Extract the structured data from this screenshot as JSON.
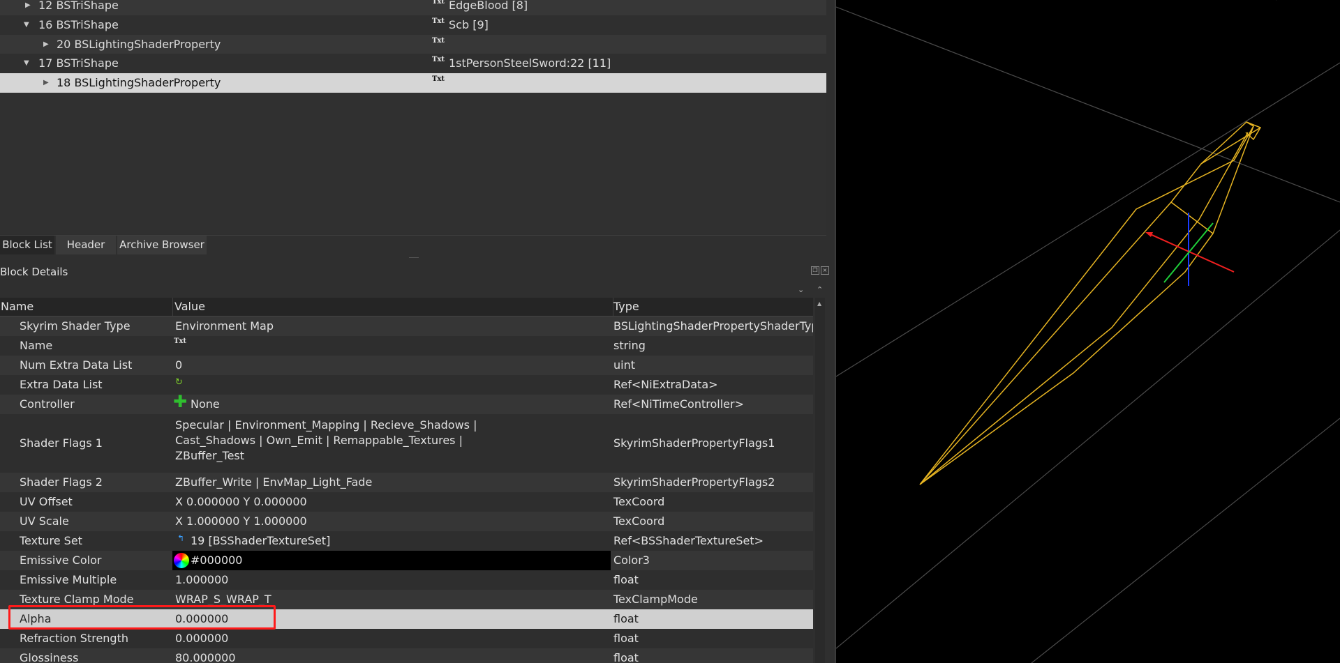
{
  "tree": {
    "rows": [
      {
        "num": "12",
        "name": "BSTriShape",
        "value": "EdgeBlood [8]",
        "txt": "Txt"
      },
      {
        "num": "16",
        "name": "BSTriShape",
        "value": "Scb [9]",
        "txt": "Txt"
      },
      {
        "num": "20",
        "name": "BSLightingShaderProperty",
        "value": "",
        "txt": "Txt"
      },
      {
        "num": "17",
        "name": "BSTriShape",
        "value": "1stPersonSteelSword:22 [11]",
        "txt": "Txt"
      },
      {
        "num": "18",
        "name": "BSLightingShaderProperty",
        "value": "",
        "txt": "Txt"
      }
    ]
  },
  "tabs": [
    "Block List",
    "Header",
    "Archive Browser"
  ],
  "details": {
    "title": "Block Details",
    "headers": {
      "name": "Name",
      "value": "Value",
      "type": "Type"
    },
    "rows": [
      {
        "name": "Skyrim Shader Type",
        "value": "Environment Map",
        "type": "BSLightingShaderPropertyShaderType"
      },
      {
        "name": "Name",
        "value": "Txt",
        "type": "string"
      },
      {
        "name": "Num Extra Data List",
        "value": "0",
        "type": "uint"
      },
      {
        "name": "Extra Data List",
        "value": "",
        "type": "Ref<NiExtraData>"
      },
      {
        "name": "Controller",
        "value": "None",
        "type": "Ref<NiTimeController>"
      },
      {
        "name": "Shader Flags 1",
        "value1": "Specular | Environment_Mapping | Recieve_Shadows |",
        "value2": "Cast_Shadows | Own_Emit | Remappable_Textures |",
        "value3": "ZBuffer_Test",
        "type": "SkyrimShaderPropertyFlags1"
      },
      {
        "name": "Shader Flags 2",
        "value": "ZBuffer_Write | EnvMap_Light_Fade",
        "type": "SkyrimShaderPropertyFlags2"
      },
      {
        "name": "UV Offset",
        "value": "X 0.000000 Y 0.000000",
        "type": "TexCoord"
      },
      {
        "name": "UV Scale",
        "value": "X 1.000000 Y 1.000000",
        "type": "TexCoord"
      },
      {
        "name": "Texture Set",
        "value": "19 [BSShaderTextureSet]",
        "type": "Ref<BSShaderTextureSet>"
      },
      {
        "name": "Emissive Color",
        "value": "#000000",
        "type": "Color3"
      },
      {
        "name": "Emissive Multiple",
        "value": "1.000000",
        "type": "float"
      },
      {
        "name": "Texture Clamp Mode",
        "value": "WRAP_S_WRAP_T",
        "type": "TexClampMode"
      },
      {
        "name": "Alpha",
        "value": "0.000000",
        "type": "float"
      },
      {
        "name": "Refraction Strength",
        "value": "0.000000",
        "type": "float"
      },
      {
        "name": "Glossiness",
        "value": "80.000000",
        "type": "float"
      }
    ]
  },
  "colors": {
    "wireframe": "#e6b422",
    "highlight": "#ff1a1a",
    "selection": "#d6d6d6",
    "grid": "#4a4a4a"
  }
}
